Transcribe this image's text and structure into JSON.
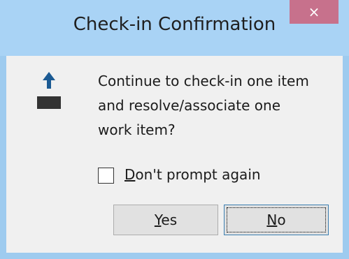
{
  "window": {
    "title": "Check-in Confirmation",
    "close_glyph": "×"
  },
  "dialog": {
    "icon": "checkin-arrow-icon",
    "message_lines": [
      "Continue to check-in one item",
      "and resolve/associate one",
      "work item?"
    ],
    "dont_prompt": {
      "mnemonic": "D",
      "rest": "on't prompt again",
      "checked": false
    },
    "buttons": {
      "yes": {
        "mnemonic": "Y",
        "rest": "es"
      },
      "no": {
        "mnemonic": "N",
        "rest": "o"
      }
    }
  },
  "colors": {
    "titlebar": "#a9d3f5",
    "close_button": "#c7718c",
    "client_bg": "#f0f0f0",
    "arrow": "#1b5a93",
    "focus_border": "#3c7fb1"
  }
}
